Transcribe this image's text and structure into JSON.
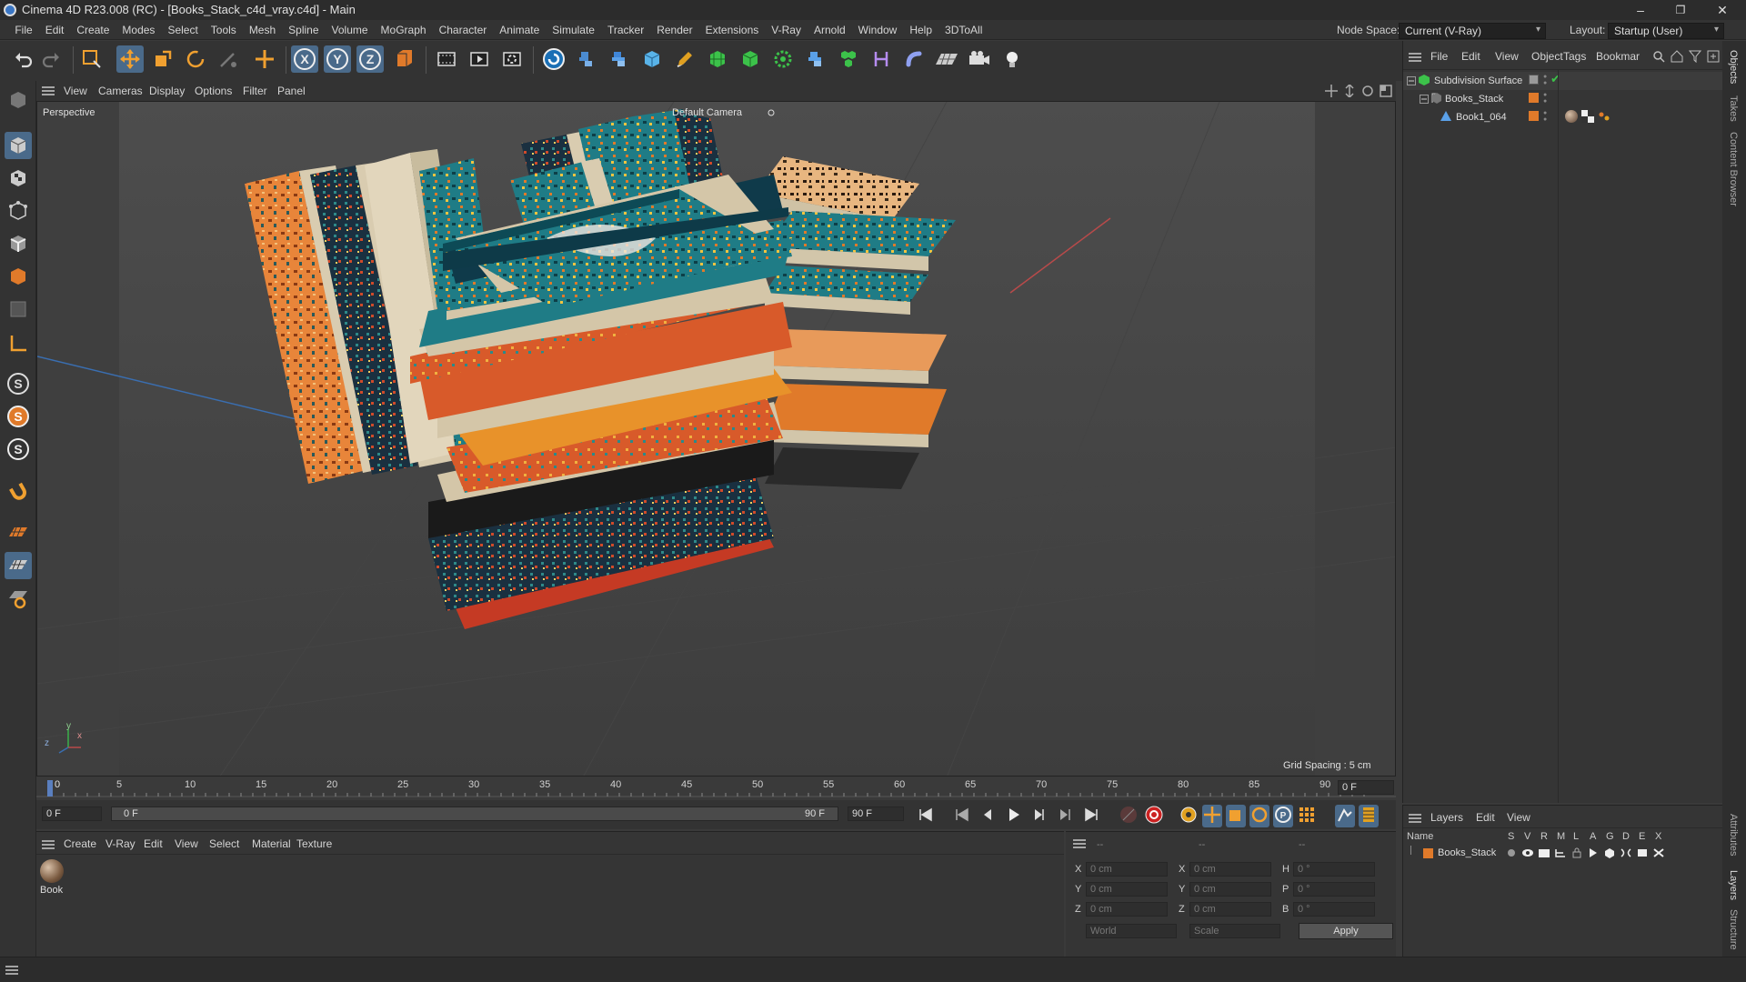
{
  "window": {
    "title": "Cinema 4D R23.008 (RC) - [Books_Stack_c4d_vray.c4d] - Main",
    "minimize_glyph": "–",
    "restore_glyph": "❐",
    "close_glyph": "✕"
  },
  "menubar": {
    "items": [
      "File",
      "Edit",
      "Create",
      "Modes",
      "Select",
      "Tools",
      "Mesh",
      "Spline",
      "Volume",
      "MoGraph",
      "Character",
      "Animate",
      "Simulate",
      "Tracker",
      "Render",
      "Extensions",
      "V-Ray",
      "Arnold",
      "Window",
      "Help",
      "3DToAll"
    ],
    "node_space_label": "Node Space:",
    "node_space_value": "Current (V-Ray)",
    "layout_label": "Layout:",
    "layout_value": "Startup (User)"
  },
  "toolbar": {
    "icons": [
      "undo-icon",
      "redo-icon",
      "live-selection-icon",
      "move-icon",
      "scale-icon",
      "rotate-icon",
      "recent-tool-icon",
      "create-tool-icon",
      "x-axis-icon",
      "y-axis-icon",
      "z-axis-icon",
      "world-coordinate-icon",
      "render-view-icon",
      "render-picture-viewer-icon",
      "render-settings-icon",
      "vray-icon",
      "python-icon",
      "python-alt-icon",
      "cube-icon",
      "pen-icon",
      "subdivision-icon",
      "extrude-icon",
      "cloner-icon",
      "python-generator-icon",
      "mograph-icon",
      "deformer-icon",
      "field-icon",
      "floor-icon",
      "camera-icon",
      "light-icon"
    ],
    "axis_x": "X",
    "axis_y": "Y",
    "axis_z": "Z"
  },
  "viewport": {
    "menu": [
      "View",
      "Cameras",
      "Display",
      "Options",
      "Filter",
      "Panel"
    ],
    "label": "Perspective",
    "camera": "Default Camera",
    "grid_spacing": "Grid Spacing : 5 cm",
    "axis_y": "y",
    "axis_z": "z",
    "axis_x": "x"
  },
  "timeline": {
    "ticks": [
      "0",
      "5",
      "10",
      "15",
      "20",
      "25",
      "30",
      "35",
      "40",
      "45",
      "50",
      "55",
      "60",
      "65",
      "70",
      "75",
      "80",
      "85",
      "90"
    ],
    "current_frame_field": "0 F",
    "start_field": "0 F",
    "range_start": "0 F",
    "range_end": "90 F",
    "end_field": "90 F"
  },
  "material_manager": {
    "menu": [
      "Create",
      "V-Ray",
      "Edit",
      "View",
      "Select",
      "Material",
      "Texture"
    ],
    "material_name": "Book"
  },
  "coordinates": {
    "header_dashes": [
      "--",
      "--",
      "--"
    ],
    "rows": [
      {
        "l1": "X",
        "v1": "0 cm",
        "l2": "X",
        "v2": "0 cm",
        "l3": "H",
        "v3": "0 °"
      },
      {
        "l1": "Y",
        "v1": "0 cm",
        "l2": "Y",
        "v2": "0 cm",
        "l3": "P",
        "v3": "0 °"
      },
      {
        "l1": "Z",
        "v1": "0 cm",
        "l2": "Z",
        "v2": "0 cm",
        "l3": "B",
        "v3": "0 °"
      }
    ],
    "mode_select": "World",
    "scale_select": "Scale",
    "apply_label": "Apply"
  },
  "object_manager": {
    "menu": [
      "File",
      "Edit",
      "View",
      "Object",
      "Tags",
      "Bookmar"
    ],
    "objects": [
      {
        "name": "Subdivision Surface"
      },
      {
        "name": "Books_Stack"
      },
      {
        "name": "Book1_064"
      }
    ]
  },
  "layer_manager": {
    "menu": [
      "Layers",
      "Edit",
      "View"
    ],
    "column_name": "Name",
    "columns": [
      "S",
      "V",
      "R",
      "M",
      "L",
      "A",
      "G",
      "D",
      "E",
      "X"
    ],
    "layers": [
      {
        "name": "Books_Stack"
      }
    ]
  },
  "side_tabs": [
    "Objects",
    "Takes",
    "Content Browser",
    "Attributes",
    "Layers",
    "Structure"
  ],
  "colors": {
    "accent_blue": "#4a6a8a",
    "layer_orange": "#e07a2a",
    "check_green": "#3cc24a"
  }
}
